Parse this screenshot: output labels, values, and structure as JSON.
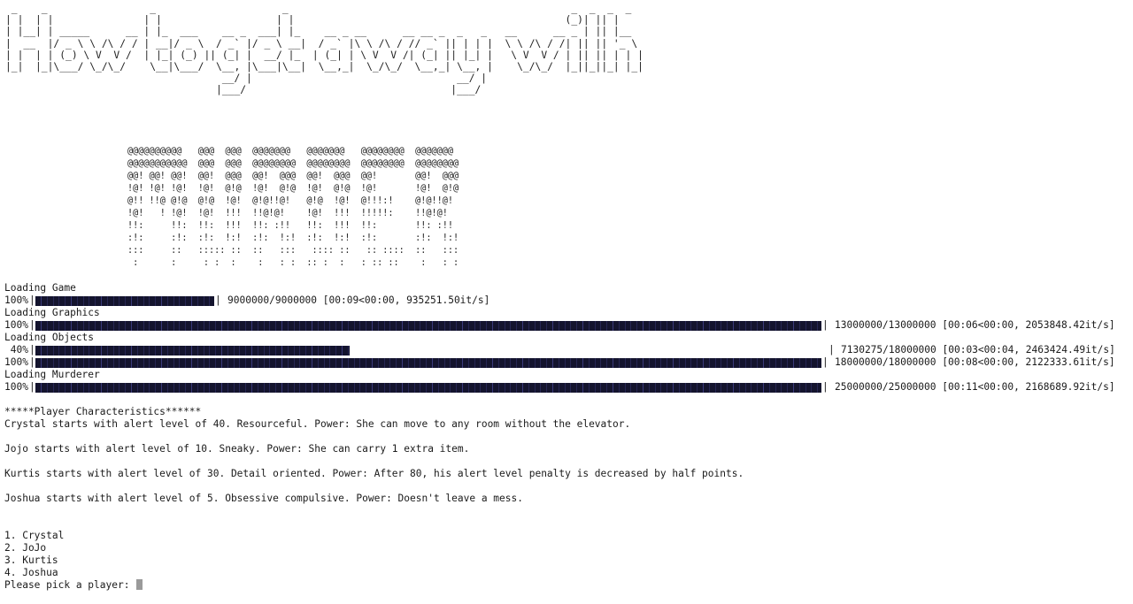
{
  "terminal": {
    "banner_art": " _    _                 _                     _                                               _  _  _  _\n| |  | |               | |                   | |                                             (_)| || |\n| |__| | _____      __ | |_  ___    __ _  ___| |_    __ _ __      __ __ _  _   _   __      __ _ | || |__\n|  __  |/ _ \\ \\ /\\ / / | __|/ _ \\  / _` |/ _ \\ __|  / _` |\\ \\ /\\ / // _` || | | |  \\ \\ /\\ / /| || || '_ \\\n| |  | | (_) \\ V  V /  | |_| (_) || (_| |  __/ |_  | (_| | \\ V  V /| (_| || |_| |   \\ V  V / | || || | | |\n|_|  |_|\\___/ \\_/\\_/    \\__|\\___/  \\__, |\\___|\\__|  \\__,_|  \\_/\\_/  \\__,_| \\__, |    \\_/\\_/  |_||_||_| |_|\n                                    __/ |                                  __/ |\n                                   |___/                                  |___/",
    "murder_art": "@@@@@@@@@@   @@@  @@@  @@@@@@@   @@@@@@@   @@@@@@@@  @@@@@@@\n@@@@@@@@@@@  @@@  @@@  @@@@@@@@  @@@@@@@@  @@@@@@@@  @@@@@@@@\n@@! @@! @@!  @@!  @@@  @@!  @@@  @@!  @@@  @@!       @@!  @@@\n!@! !@! !@!  !@!  @!@  !@!  @!@  !@!  @!@  !@!       !@!  @!@\n@!! !!@ @!@  @!@  !@!  @!@!!@!   @!@  !@!  @!!!:!    @!@!!@!\n!@!   ! !@!  !@!  !!!  !!@!@!    !@!  !!!  !!!!!:    !!@!@!\n!!:     !!:  !!:  !!!  !!: :!!   !!:  !!!  !!:       !!: :!!\n:!:     :!:  :!:  !:!  :!:  !:!  :!:  !:!  :!:       :!:  !:!\n:::     ::   ::::: ::  ::   :::   :::: ::   :: ::::  ::   :::\n :      :     : :  :    :   : :  :: :  :   : :: ::    :   : :",
    "progress": [
      {
        "label": "Loading Game",
        "percent_text": "100%",
        "fraction": 1.0,
        "stats": "9000000/9000000 [00:09<00:00, 935251.50it/s]"
      },
      {
        "label": "Loading Graphics",
        "percent_text": "100%",
        "fraction": 1.0,
        "stats": "13000000/13000000 [00:06<00:00, 2053848.42it/s]"
      },
      {
        "label": "Loading Objects",
        "percent_text": " 40%",
        "fraction": 0.4,
        "stats": "7130275/18000000 [00:03<00:04, 2463424.49it/s]"
      },
      {
        "percent_text": "100%",
        "fraction": 1.0,
        "stats": "18000000/18000000 [00:08<00:00, 2122333.61it/s]"
      },
      {
        "label": "Loading Murderer",
        "percent_text": "100%",
        "fraction": 1.0,
        "stats": "25000000/25000000 [00:11<00:00, 2168689.92it/s]"
      }
    ],
    "characteristics_heading": "*****Player Characteristics******",
    "characteristics": [
      "Crystal starts with alert level of 40. Resourceful. Power: She can move to any room without the elevator.",
      "Jojo starts with alert level of 10. Sneaky. Power: She can carry 1 extra item.",
      "Kurtis starts with alert level of 30. Detail oriented. Power: After 80, his alert level penalty is decreased by half points.",
      "Joshua starts with alert level of 5. Obsessive compulsive. Power: Doesn't leave a mess."
    ],
    "menu": [
      "1. Crystal",
      "2. JoJo",
      "3. Kurtis",
      "4. Joshua"
    ],
    "prompt": "Please pick a player: ",
    "bar_color": "#14142e"
  }
}
